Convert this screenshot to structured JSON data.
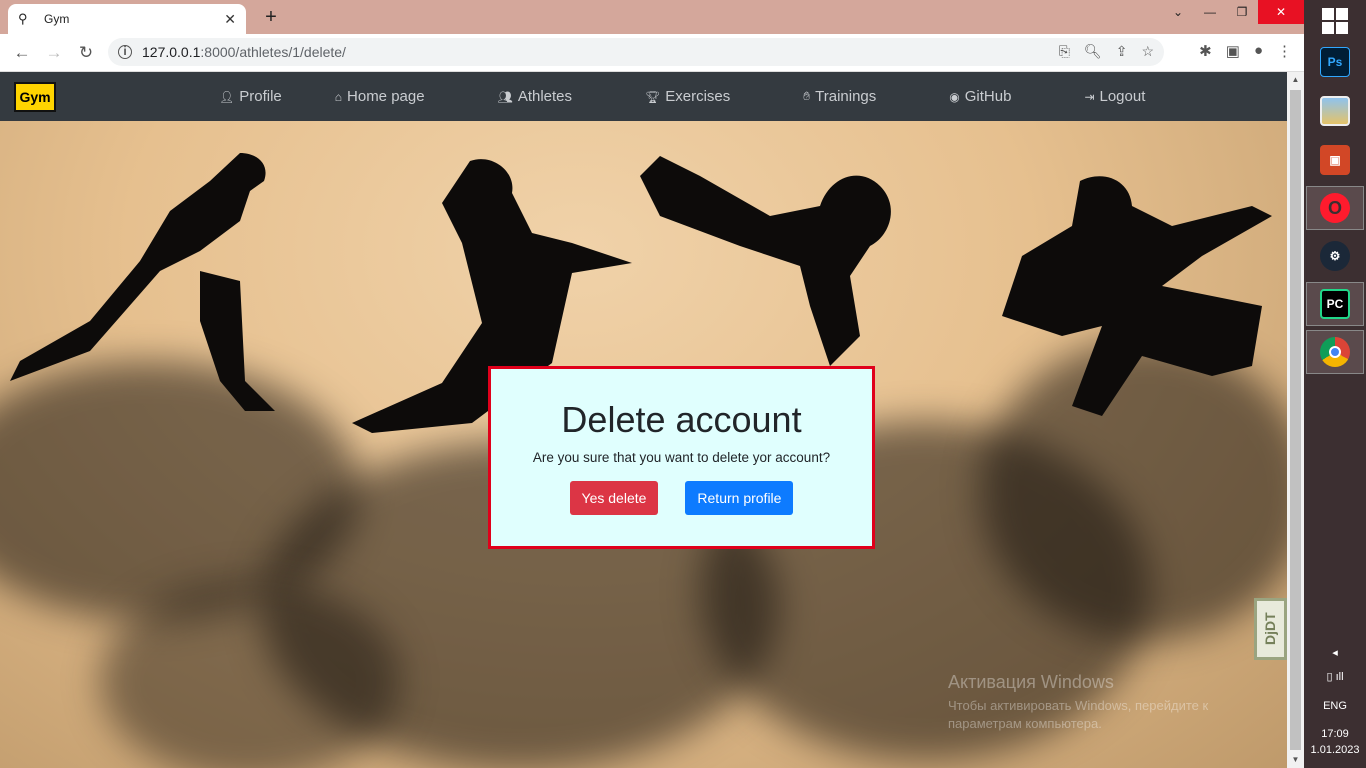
{
  "browser": {
    "tab_title": "Gym",
    "url_host": "127.0.0.1",
    "url_path": ":8000/athletes/1/delete/"
  },
  "nav": {
    "brand": "Gym",
    "links": [
      {
        "label": "Profile",
        "icon": "user-icon"
      },
      {
        "label": "Home page",
        "icon": "home-icon"
      },
      {
        "label": "Athletes",
        "icon": "users-icon"
      },
      {
        "label": "Exercises",
        "icon": "trophy-icon"
      },
      {
        "label": "Trainings",
        "icon": "hand-icon"
      },
      {
        "label": "GitHub",
        "icon": "github-icon"
      },
      {
        "label": "Logout",
        "icon": "logout-icon"
      }
    ]
  },
  "modal": {
    "title": "Delete account",
    "text": "Are you sure that you want to delete yor account?",
    "confirm_label": "Yes delete",
    "cancel_label": "Return profile"
  },
  "watermark": {
    "line1": "Активация Windows",
    "line2": "Чтобы активировать Windows, перейдите к параметрам компьютера."
  },
  "debug_toolbar": {
    "label": "DjDT"
  },
  "taskbar": {
    "apps": [
      "photoshop-icon",
      "photos-icon",
      "powerpoint-icon",
      "opera-icon",
      "steam-icon",
      "pycharm-icon",
      "chrome-icon"
    ],
    "language": "ENG",
    "time": "17:09",
    "date": "1.01.2023"
  },
  "colors": {
    "navbar": "#343a40",
    "brand": "#ffd400",
    "modal_bg": "#e0fffe",
    "modal_border": "#e0001b",
    "danger": "#dc3545",
    "primary": "#0d7bff"
  }
}
